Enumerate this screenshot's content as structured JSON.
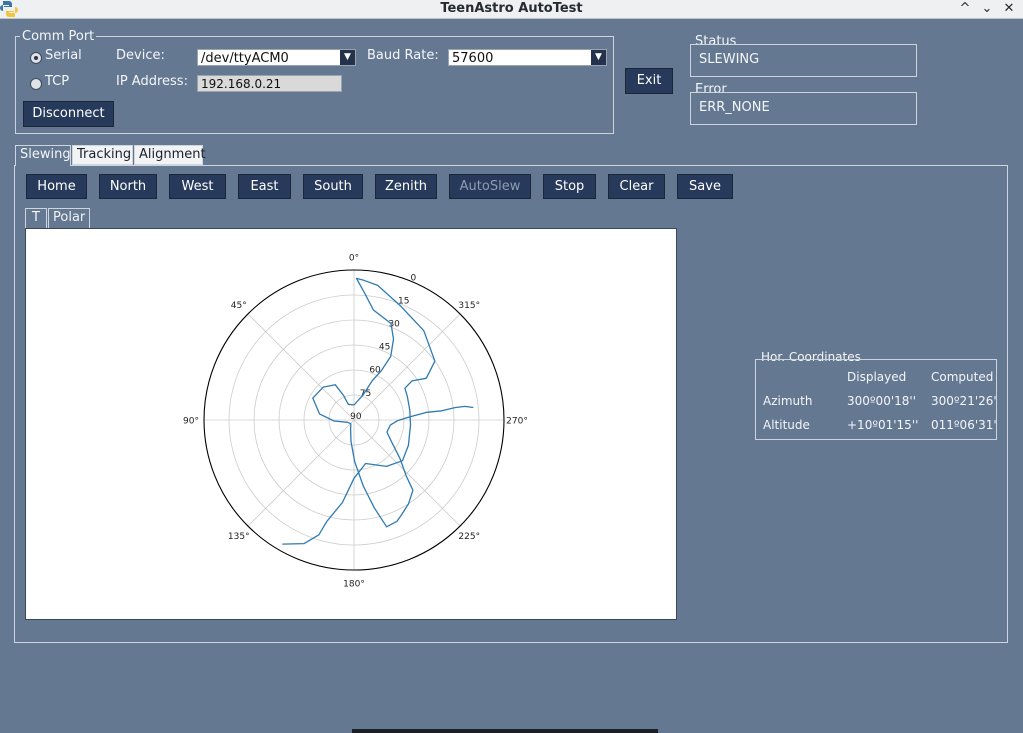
{
  "window": {
    "title": "TeenAstro AutoTest",
    "controls": [
      "^",
      "⌄",
      "✕"
    ]
  },
  "comm_port": {
    "legend": "Comm Port",
    "serial_label": "Serial",
    "tcp_label": "TCP",
    "serial_selected": true,
    "device_label": "Device:",
    "device_value": "/dev/ttyACM0",
    "baud_label": "Baud Rate:",
    "baud_value": "57600",
    "ip_label": "IP Address:",
    "ip_value": "192.168.0.21",
    "disconnect_label": "Disconnect"
  },
  "exit_label": "Exit",
  "status": {
    "legend": "Status",
    "value": "SLEWING"
  },
  "error": {
    "legend": "Error",
    "value": "ERR_NONE"
  },
  "tabs": [
    {
      "label": "Slewing",
      "active": true
    },
    {
      "label": "Tracking",
      "active": false
    },
    {
      "label": "Alignment",
      "active": false
    }
  ],
  "slew_buttons": [
    {
      "label": "Home",
      "enabled": true
    },
    {
      "label": "North",
      "enabled": true
    },
    {
      "label": "West",
      "enabled": true
    },
    {
      "label": "East",
      "enabled": true
    },
    {
      "label": "South",
      "enabled": true
    },
    {
      "label": "Zenith",
      "enabled": true
    },
    {
      "label": "AutoSlew",
      "enabled": false
    },
    {
      "label": "Stop",
      "enabled": true
    },
    {
      "label": "Clear",
      "enabled": true
    },
    {
      "label": "Save",
      "enabled": true
    }
  ],
  "subtabs": [
    {
      "label": "T",
      "active": true
    },
    {
      "label": "Polar",
      "active": false
    }
  ],
  "hor_coords": {
    "legend": "Hor. Coordinates",
    "col_displayed": "Displayed",
    "col_computed": "Computed",
    "rows": [
      {
        "label": "Azimuth",
        "displayed": "300º00'18''",
        "computed": "300º21'26'"
      },
      {
        "label": "Altitude",
        "displayed": "+10º01'15''",
        "computed": "011º06'31'"
      }
    ]
  },
  "chart_data": {
    "type": "line",
    "projection": "polar",
    "theta_direction": "counterclockwise",
    "theta_zero": "top",
    "theta_ticks": [
      "0°",
      "45°",
      "90°",
      "135°",
      "180°",
      "225°",
      "270°",
      "315°"
    ],
    "r_ticks": [
      "0",
      "15",
      "30",
      "45",
      "60",
      "75",
      "90"
    ],
    "r_axis": "altitude, 0 at edge to 90 at center",
    "grid": true,
    "series": [
      {
        "color": "#2e7ab3",
        "points": [
          [
            276,
            18
          ],
          [
            277,
            23
          ],
          [
            277,
            29
          ],
          [
            276,
            37
          ],
          [
            276,
            46
          ],
          [
            273,
            57
          ],
          [
            269,
            64
          ],
          [
            262,
            68
          ],
          [
            250,
            69
          ],
          [
            240,
            64
          ],
          [
            230,
            54
          ],
          [
            223,
            44
          ],
          [
            220,
            35
          ],
          [
            213,
            30
          ],
          [
            206,
            26
          ],
          [
            203,
            24
          ],
          [
            197,
            23
          ],
          [
            193,
            36
          ],
          [
            188,
            50
          ],
          [
            181,
            65
          ],
          [
            172,
            77
          ],
          [
            160,
            84
          ],
          [
            140,
            87
          ],
          [
            110,
            86
          ],
          [
            93,
            78
          ],
          [
            80,
            69
          ],
          [
            62,
            62
          ],
          [
            43,
            63
          ],
          [
            28,
            66
          ],
          [
            23,
            74
          ],
          [
            20,
            80
          ],
          [
            0,
            81
          ],
          [
            340,
            74
          ],
          [
            335,
            64
          ],
          [
            331,
            56
          ],
          [
            330,
            46
          ],
          [
            334,
            36
          ],
          [
            339,
            28
          ],
          [
            350,
            23
          ],
          [
            355,
            14
          ],
          [
            359,
            5
          ],
          [
            356,
            6
          ],
          [
            350,
            8
          ],
          [
            338,
            16
          ],
          [
            322,
            22
          ],
          [
            306,
            30
          ],
          [
            300,
            40
          ],
          [
            304,
            48
          ],
          [
            302,
            54
          ],
          [
            294,
            55
          ],
          [
            280,
            56
          ],
          [
            265,
            56
          ],
          [
            245,
            54
          ],
          [
            230,
            52
          ],
          [
            215,
            56
          ],
          [
            195,
            63
          ],
          [
            180,
            55
          ],
          [
            172,
            40
          ],
          [
            165,
            27
          ],
          [
            163,
            18
          ],
          [
            158,
            10
          ],
          [
            150,
            4
          ]
        ]
      }
    ]
  }
}
